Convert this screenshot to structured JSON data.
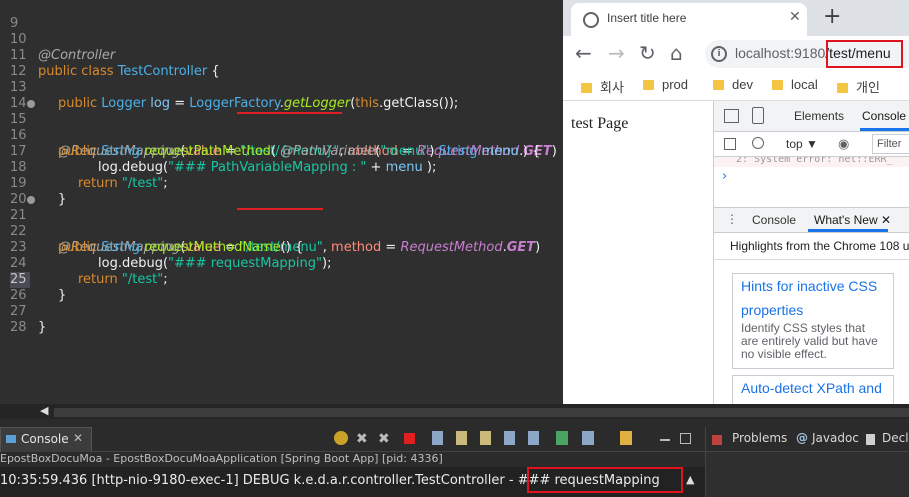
{
  "editor": {
    "lines": [
      {
        "n": "9"
      },
      {
        "n": "10"
      },
      {
        "n": "11"
      },
      {
        "n": "12"
      },
      {
        "n": "13"
      },
      {
        "n": "14"
      },
      {
        "n": "15"
      },
      {
        "n": "16"
      },
      {
        "n": "17"
      },
      {
        "n": "18"
      },
      {
        "n": "19"
      },
      {
        "n": "20"
      },
      {
        "n": "21"
      },
      {
        "n": "22"
      },
      {
        "n": "23"
      },
      {
        "n": "24"
      },
      {
        "n": "25"
      },
      {
        "n": "26"
      },
      {
        "n": "27"
      },
      {
        "n": "28"
      }
    ],
    "t": {
      "controller_ann": "@Controller",
      "public": "public",
      "class": "class",
      "class_name": "TestController",
      "brace_open": " {",
      "logger_type": "Logger",
      "log_var": "log",
      "eq": " = ",
      "logger_factory": "LoggerFactory",
      "dot": ".",
      "get_logger": "getLogger",
      "paren_open": "(",
      "this": "this",
      "get_class": ".getClass",
      "close_semi": "());",
      "req_mapping": "@RequestMapping",
      "value": "value",
      "eq_nospace": " = ",
      "path_var_url": "\"/test/{menu}\"",
      "comma": ", ",
      "method": "method",
      "request_method": "RequestMethod",
      "get": "GET",
      "paren_close": ")",
      "string_type": "String",
      "request_path_method": "requestPathMethod",
      "path_variable_ann": "@PathVariable",
      "menu_str": "\"menu\"",
      "menu_var": "menu",
      "paren_close_brace": " ) {",
      "log_debug": "log.debug(",
      "path_var_msg": "\"### PathVariableMapping : \"",
      "plus": " + ",
      "close_paren_semi": " );",
      "return": "return",
      "return_val": "\"/test\"",
      "semi": ";",
      "brace_close": "}",
      "menu_url": "\"/test/menu\"",
      "request_method_name": "requestMethodName",
      "method_sig_end": "() {",
      "req_mapping_msg": "\"### requestMapping\"",
      "close_paren_semi2": ");"
    }
  },
  "browser": {
    "tab_title": "Insert title here",
    "tab_close": "✕",
    "new_tab": "+",
    "back": "←",
    "forward": "→",
    "reload": "↻",
    "home": "⌂",
    "url_host": "localhost:9180",
    "url_path": "/test/menu",
    "bookmarks": [
      "회사",
      "prod",
      "dev",
      "local",
      "개인"
    ],
    "page_text": "test Page"
  },
  "devtools": {
    "elements_tab": "Elements",
    "console_tab": "Console",
    "top_context": "top ▼",
    "filter_placeholder": "Filter",
    "error_text": "2: System error: net::ERR_",
    "prompt": "›",
    "drawer_console": "Console",
    "drawer_whats_new": "What's New ✕",
    "highlights": "Highlights from the Chrome 108 u",
    "card1_title_1": "Hints for inactive CSS",
    "card1_title_2": "properties",
    "card1_body": "Identify CSS styles that are entirely valid but have no visible effect.",
    "card2_title": "Auto-detect XPath and"
  },
  "console_view": {
    "tab_label": "Console",
    "tab_close": "✕",
    "launch_line": "EpostBoxDocuMoa - EpostBoxDocuMoaApplication [Spring Boot App]  [pid: 4336]",
    "log_prefix": "10:35:59.436 [http-nio-9180-exec-1] DEBUG k.e.d.a.r.controller.TestController - ",
    "log_message": "### requestMapping",
    "scroll_up": "▲"
  },
  "right_views": {
    "problems": "Problems",
    "javadoc": "Javadoc",
    "declaration": "Decla"
  },
  "colors": {
    "highlight_red": "#e0141e",
    "editor_bg": "#2f2f2f"
  }
}
